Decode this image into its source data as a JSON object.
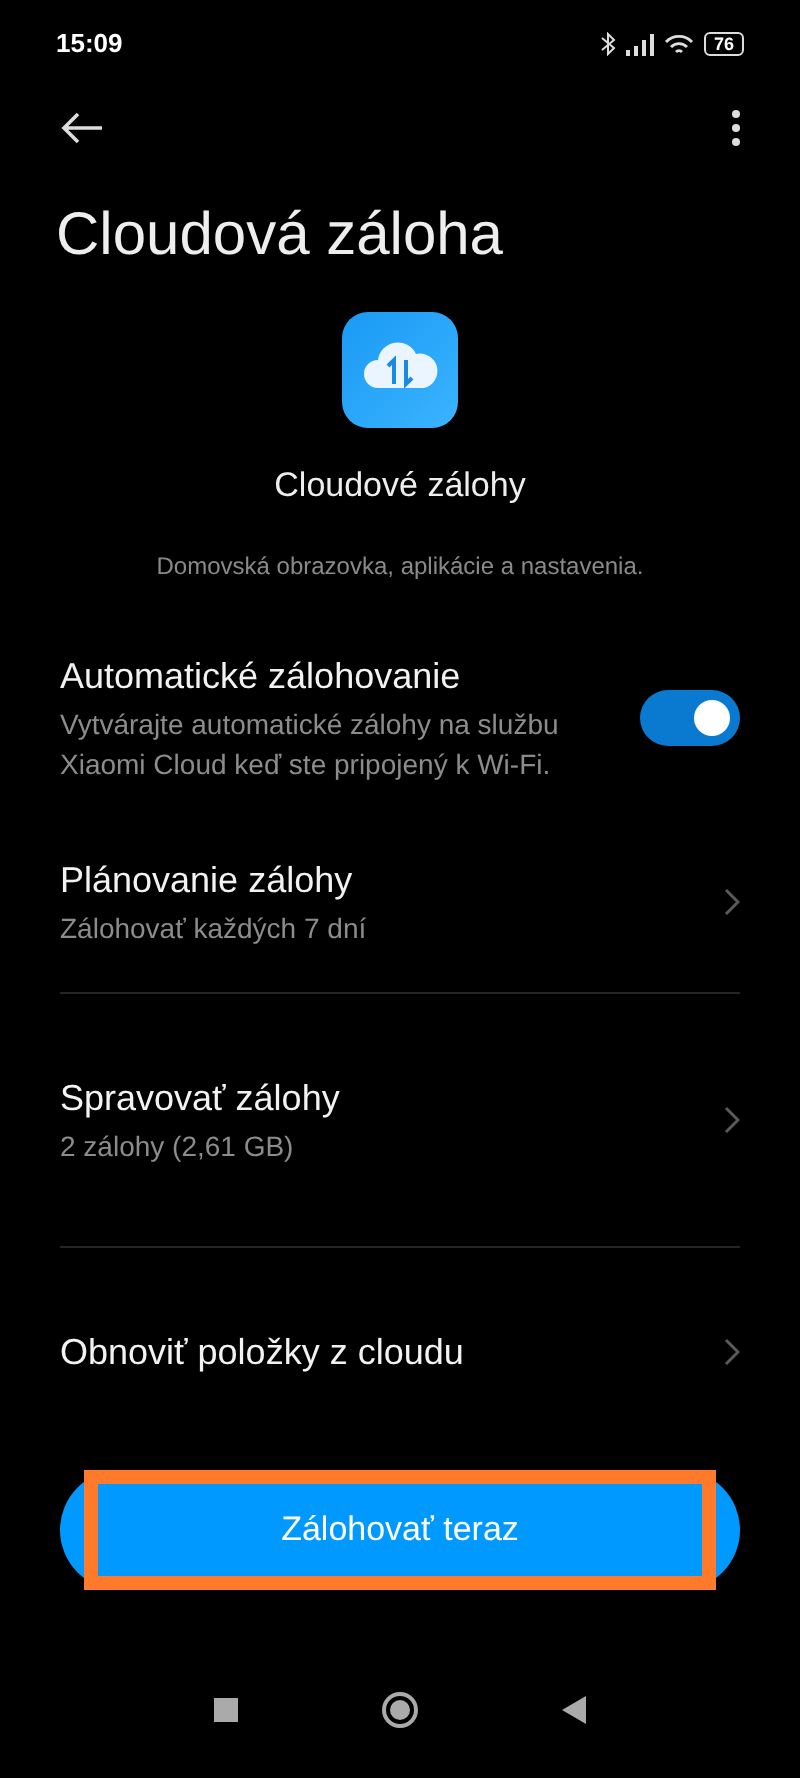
{
  "status_bar": {
    "time": "15:09",
    "battery": "76"
  },
  "header": {
    "title": "Cloudová záloha"
  },
  "hero": {
    "name": "Cloudové zálohy",
    "description": "Domovská obrazovka, aplikácie a nastavenia."
  },
  "sections": [
    {
      "items": [
        {
          "kind": "toggle",
          "title": "Automatické zálohovanie",
          "subtitle": "Vytvárajte automatické zálohy na službu Xiaomi Cloud keď ste pripojený k Wi-Fi.",
          "on": true
        },
        {
          "kind": "link",
          "title": "Plánovanie zálohy",
          "subtitle": "Zálohovať každých 7 dní"
        }
      ]
    },
    {
      "items": [
        {
          "kind": "link",
          "title": "Spravovať zálohy",
          "subtitle": "2 zálohy (2,61 GB)"
        }
      ]
    },
    {
      "items": [
        {
          "kind": "link",
          "title": "Obnoviť položky z cloudu"
        }
      ]
    }
  ],
  "primary_button": {
    "label": "Zálohovať teraz",
    "highlighted": true
  }
}
